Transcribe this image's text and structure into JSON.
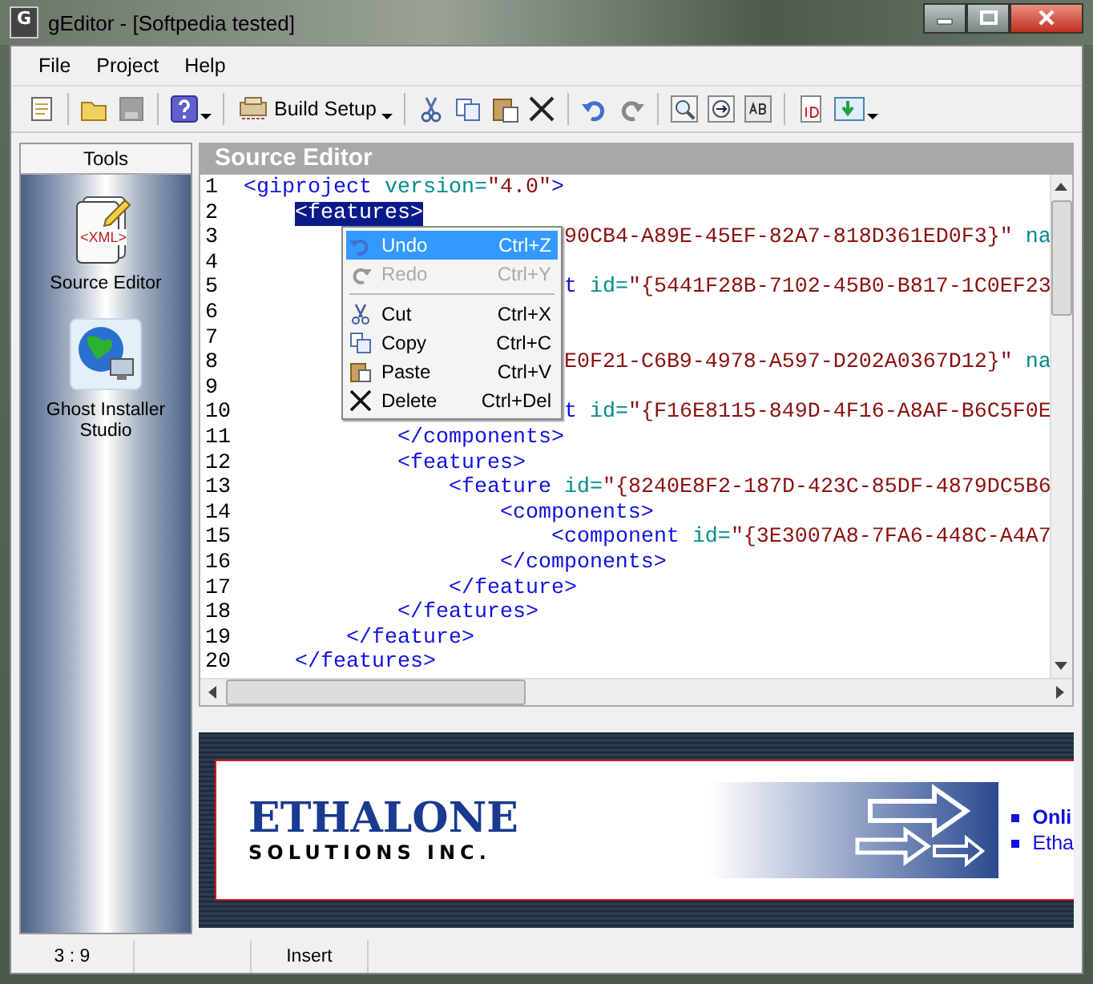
{
  "window": {
    "title": "gEditor - [Softpedia tested]",
    "icon_text": "G"
  },
  "menu_bar": [
    "File",
    "Project",
    "Help"
  ],
  "toolbar": {
    "build_setup_label": "Build Setup"
  },
  "tools_panel": {
    "title": "Tools",
    "items": [
      {
        "label": "Source Editor",
        "kind": "xml",
        "icon_text": "<XML>"
      },
      {
        "label": "Ghost Installer Studio",
        "kind": "globe"
      }
    ]
  },
  "editor": {
    "title": "Source Editor",
    "lines": [
      {
        "number": "1",
        "covered": false,
        "segments": [
          {
            "kind": "tag",
            "text": "<giproject"
          },
          {
            "kind": "attr",
            "text": "version="
          },
          {
            "kind": "value",
            "text": "\"4.0\""
          },
          {
            "kind": "tag",
            "text": ">"
          }
        ],
        "children": [
          {
            "number": "2",
            "covered": false,
            "segments": [
              {
                "kind": "selection",
                "text": "<features>"
              }
            ],
            "children": [
              {
                "number": "3",
                "covered": true,
                "segments": [
                  {
                    "kind": "value",
                    "text": "90CB4-A89E-45EF-82A7-818D361ED0F3}\""
                  },
                  {
                    "kind": "attr",
                    "text": "na"
                  }
                ],
                "children": [
                  {
                    "number": "4"
                  },
                  {
                    "number": "5",
                    "covered": true,
                    "segments": [
                      {
                        "kind": "tag",
                        "text": "t"
                      },
                      {
                        "kind": "attr",
                        "text": "id="
                      },
                      {
                        "kind": "value",
                        "text": "\"{5441F28B-7102-45B0-B817-1C0EF23"
                      }
                    ]
                  },
                  {
                    "number": "6"
                  }
                ]
              },
              {
                "number": "7"
              },
              {
                "number": "8",
                "covered": true,
                "segments": [
                  {
                    "kind": "value",
                    "text": "E0F21-C6B9-4978-A597-D202A0367D12}\""
                  },
                  {
                    "kind": "attr",
                    "text": "na"
                  }
                ],
                "children": [
                  {
                    "number": "9"
                  },
                  {
                    "number": "10",
                    "covered": true,
                    "segments": [
                      {
                        "kind": "tag",
                        "text": "t"
                      },
                      {
                        "kind": "attr",
                        "text": "id="
                      },
                      {
                        "kind": "value",
                        "text": "\"{F16E8115-849D-4F16-A8AF-B6C5F0E"
                      }
                    ]
                  },
                  {
                    "number": "11",
                    "covered": false,
                    "segments": [
                      {
                        "kind": "tag",
                        "text": "</components>"
                      }
                    ]
                  },
                  {
                    "number": "12",
                    "covered": false,
                    "segments": [
                      {
                        "kind": "tag",
                        "text": "<features>"
                      }
                    ],
                    "children": [
                      {
                        "number": "13",
                        "covered": false,
                        "segments": [
                          {
                            "kind": "tag",
                            "text": "<feature"
                          },
                          {
                            "kind": "attr",
                            "text": "id="
                          },
                          {
                            "kind": "value",
                            "text": "\"{8240E8F2-187D-423C-85DF-4879DC5B6"
                          }
                        ],
                        "children": [
                          {
                            "number": "14",
                            "covered": false,
                            "segments": [
                              {
                                "kind": "tag",
                                "text": "<components>"
                              }
                            ],
                            "children": [
                              {
                                "number": "15",
                                "covered": false,
                                "segments": [
                                  {
                                    "kind": "tag",
                                    "text": "<component"
                                  },
                                  {
                                    "kind": "attr",
                                    "text": "id="
                                  },
                                  {
                                    "kind": "value",
                                    "text": "\"{3E3007A8-7FA6-448C-A4A7"
                                  }
                                ]
                              }
                            ]
                          },
                          {
                            "number": "16",
                            "covered": false,
                            "segments": [
                              {
                                "kind": "tag",
                                "text": "</components>"
                              }
                            ]
                          }
                        ]
                      },
                      {
                        "number": "17",
                        "covered": false,
                        "segments": [
                          {
                            "kind": "tag",
                            "text": "</feature>"
                          }
                        ]
                      }
                    ]
                  },
                  {
                    "number": "18",
                    "covered": false,
                    "segments": [
                      {
                        "kind": "tag",
                        "text": "</features>"
                      }
                    ]
                  }
                ]
              },
              {
                "number": "19",
                "covered": false,
                "segments": [
                  {
                    "kind": "tag",
                    "text": "</feature>"
                  }
                ]
              }
            ]
          },
          {
            "number": "20",
            "covered": false,
            "segments": [
              {
                "kind": "tag",
                "text": "</features>"
              }
            ]
          }
        ]
      }
    ]
  },
  "context_menu": [
    {
      "kind": "undo",
      "label": "Undo",
      "shortcut": "Ctrl+Z",
      "selected": true,
      "disabled": false
    },
    {
      "kind": "redo",
      "label": "Redo",
      "shortcut": "Ctrl+Y",
      "selected": false,
      "disabled": true
    },
    {
      "kind": "separator"
    },
    {
      "kind": "cut",
      "label": "Cut",
      "shortcut": "Ctrl+X",
      "selected": false,
      "disabled": false
    },
    {
      "kind": "copy",
      "label": "Copy",
      "shortcut": "Ctrl+C",
      "selected": false,
      "disabled": false
    },
    {
      "kind": "paste",
      "label": "Paste",
      "shortcut": "Ctrl+V",
      "selected": false,
      "disabled": false
    },
    {
      "kind": "delete",
      "label": "Delete",
      "shortcut": "Ctrl+Del",
      "selected": false,
      "disabled": false
    }
  ],
  "banner": {
    "logo_name": "ETHALONE",
    "logo_subtitle": "SOLUTIONS INC.",
    "links": [
      {
        "text": "Onli",
        "bold": true
      },
      {
        "text": "Etha",
        "bold": false
      }
    ]
  },
  "status_bar": {
    "position": "3 : 9",
    "mode": "Insert"
  }
}
